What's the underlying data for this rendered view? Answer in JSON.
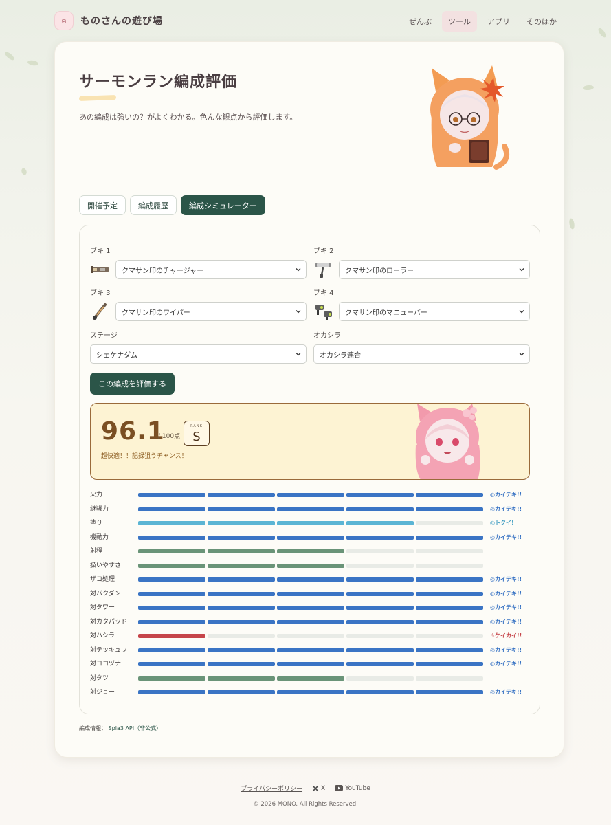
{
  "site": {
    "logo_char": "ฅ",
    "name": "ものさんの遊び場"
  },
  "nav": [
    {
      "label": "ぜんぶ",
      "active": false
    },
    {
      "label": "ツール",
      "active": true
    },
    {
      "label": "アプリ",
      "active": false
    },
    {
      "label": "そのほか",
      "active": false
    }
  ],
  "page": {
    "title": "サーモンラン編成評価",
    "subtitle": "あの編成は強いの？がよくわかる。色んな観点から評価します。"
  },
  "tabs": [
    {
      "label": "開催予定",
      "active": false
    },
    {
      "label": "編成履歴",
      "active": false
    },
    {
      "label": "編成シミュレーター",
      "active": true
    }
  ],
  "form": {
    "buki1": {
      "label": "ブキ 1",
      "value": "クマサン印のチャージャー",
      "icon": "charger-icon"
    },
    "buki2": {
      "label": "ブキ 2",
      "value": "クマサン印のローラー",
      "icon": "roller-icon"
    },
    "buki3": {
      "label": "ブキ 3",
      "value": "クマサン印のワイパー",
      "icon": "wiper-icon"
    },
    "buki4": {
      "label": "ブキ 4",
      "value": "クマサン印のマニューバー",
      "icon": "maneuver-icon"
    },
    "stage": {
      "label": "ステージ",
      "value": "シェケナダム"
    },
    "boss": {
      "label": "オカシラ",
      "value": "オカシラ連合"
    },
    "submit_label": "この編成を評価する"
  },
  "result": {
    "score": "96.1",
    "max_label": "/ 100点",
    "rank_caption": "RANK",
    "rank": "S",
    "comment": "超快適！！記録狙うチャンス！"
  },
  "stats": [
    {
      "name": "火力",
      "level": 5,
      "tone": "blue",
      "tag": "◎カイテキ!!"
    },
    {
      "name": "継戦力",
      "level": 5,
      "tone": "blue",
      "tag": "◎カイテキ!!"
    },
    {
      "name": "塗り",
      "level": 4,
      "tone": "cyan",
      "tag": "◎トクイ!"
    },
    {
      "name": "機動力",
      "level": 5,
      "tone": "blue",
      "tag": "◎カイテキ!!"
    },
    {
      "name": "射程",
      "level": 3,
      "tone": "green",
      "tag": ""
    },
    {
      "name": "扱いやすさ",
      "level": 3,
      "tone": "green",
      "tag": ""
    },
    {
      "name": "ザコ処理",
      "level": 5,
      "tone": "blue",
      "tag": "◎カイテキ!!"
    },
    {
      "name": "対バクダン",
      "level": 5,
      "tone": "blue",
      "tag": "◎カイテキ!!"
    },
    {
      "name": "対タワー",
      "level": 5,
      "tone": "blue",
      "tag": "◎カイテキ!!"
    },
    {
      "name": "対カタパッド",
      "level": 5,
      "tone": "blue",
      "tag": "◎カイテキ!!"
    },
    {
      "name": "対ハシラ",
      "level": 1,
      "tone": "red",
      "tag": "⚠ケイカイ!!"
    },
    {
      "name": "対テッキュウ",
      "level": 5,
      "tone": "blue",
      "tag": "◎カイテキ!!"
    },
    {
      "name": "対ヨコヅナ",
      "level": 5,
      "tone": "blue",
      "tag": "◎カイテキ!!"
    },
    {
      "name": "対タツ",
      "level": 3,
      "tone": "green",
      "tag": ""
    },
    {
      "name": "対ジョー",
      "level": 5,
      "tone": "blue",
      "tag": "◎カイテキ!!"
    }
  ],
  "colors": {
    "blue": "#3a74c4",
    "cyan": "#5bb5d4",
    "green": "#6a9478",
    "red": "#c6454a",
    "empty": "#e8ebe6"
  },
  "source": {
    "label": "編成情報：",
    "link": "Spla3 API（非公式）"
  },
  "footer": {
    "privacy": "プライバシーポリシー",
    "x": "X",
    "youtube": "YouTube",
    "copyright": "© 2026 MONO. All Rights Reserved."
  }
}
